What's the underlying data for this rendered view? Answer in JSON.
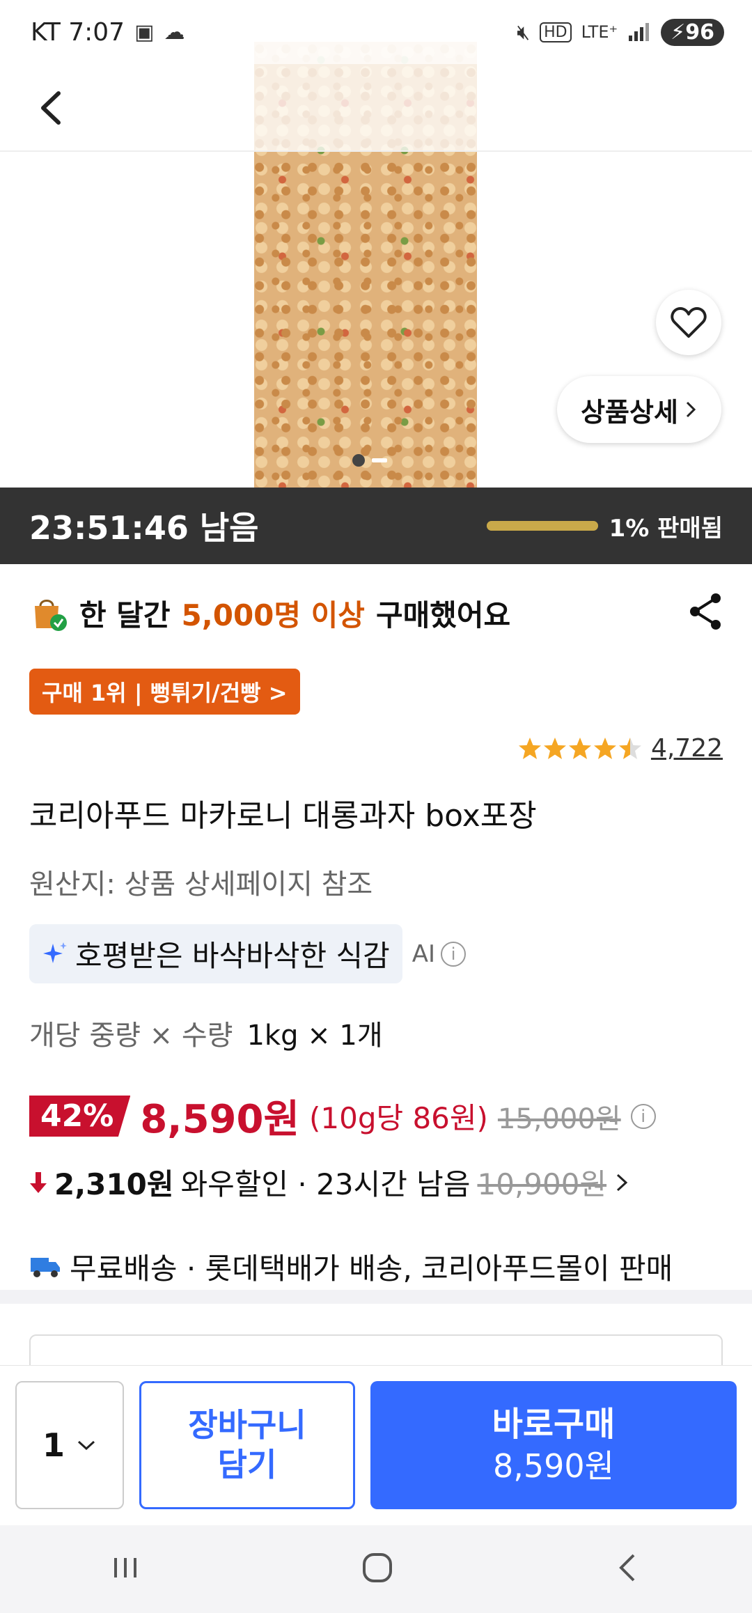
{
  "status_bar": {
    "carrier_time": "KT 7:07",
    "network": "LTE⁺",
    "hd": "HD",
    "battery": "96"
  },
  "hero": {
    "detail_button_label": "상품상세"
  },
  "timer": {
    "remaining_text": "23:51:46 남음",
    "sold_text": "1% 판매됨",
    "sold_fraction": 0.01
  },
  "buyers": {
    "prefix": "한 달간",
    "highlight": "5,000명 이상",
    "suffix": "구매했어요"
  },
  "rank_badge": "구매 1위 | 뻥튀기/건빵 >",
  "rating": {
    "stars": 4.5,
    "review_count": "4,722"
  },
  "product": {
    "title": "코리아푸드 마카로니 대롱과자 box포장",
    "origin": "원산지: 상품 상세페이지 참조",
    "ai_summary": "호평받은 바삭바삭한 식감",
    "ai_label": "AI",
    "weight_label": "개당 중량 × 수량",
    "weight_value": "1kg × 1개"
  },
  "price": {
    "discount": "42%",
    "sale": "8,590원",
    "unit": "(10g당 86원)",
    "original": "15,000원"
  },
  "wow": {
    "amount": "2,310원",
    "text": "와우할인 · 23시간 남음",
    "original": "10,900원"
  },
  "shipping": {
    "text": "무료배송 · 롯데택배가 배송, 코리아푸드몰이 판매"
  },
  "buy_bar": {
    "quantity": "1",
    "cart_line1": "장바구니",
    "cart_line2": "담기",
    "buy_label": "바로구매",
    "buy_price": "8,590원"
  },
  "colors": {
    "accent_blue": "#346aff",
    "price_red": "#c8102e",
    "badge_orange": "#e35b12",
    "timer_bg": "#333333"
  }
}
